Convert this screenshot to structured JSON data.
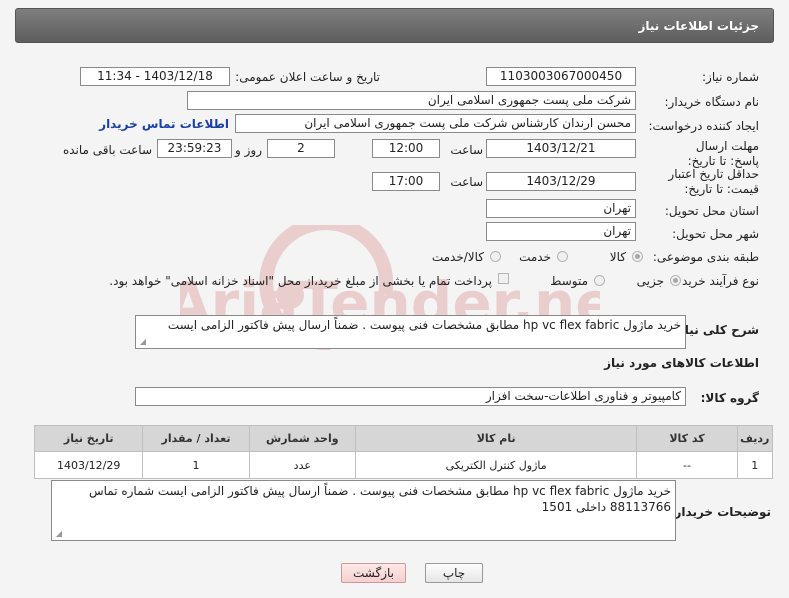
{
  "header": {
    "title": "جزئیات اطلاعات نیاز"
  },
  "fields": {
    "need_number_label": "شماره نیاز:",
    "need_number": "1103003067000450",
    "announce_label": "تاریخ و ساعت اعلان عمومی:",
    "announce_value": "1403/12/18 - 11:34",
    "buyer_org_label": "نام دستگاه خریدار:",
    "buyer_org": "شرکت ملی پست جمهوری اسلامی ایران",
    "requester_label": "ایجاد کننده درخواست:",
    "requester": "محسن ارندان کارشناس شرکت ملی پست جمهوری اسلامی ایران",
    "buyer_contact_link": "اطلاعات تماس خریدار",
    "reply_deadline_label": "مهلت ارسال پاسخ: تا تاریخ:",
    "reply_date": "1403/12/21",
    "time_label": "ساعت",
    "reply_time": "12:00",
    "days": "2",
    "days_label": "روز و",
    "remaining_time": "23:59:23",
    "remaining_label": "ساعت باقی مانده",
    "price_validity_label": "حداقل تاریخ اعتبار قیمت: تا تاریخ:",
    "price_date": "1403/12/29",
    "price_time": "17:00",
    "province_label": "استان محل تحویل:",
    "province": "تهران",
    "city_label": "شهر محل تحویل:",
    "city": "تهران",
    "category_label": "طبقه بندی موضوعی:",
    "category_options": [
      "کالا",
      "خدمت",
      "کالا/خدمت"
    ],
    "process_label": "نوع فرآیند خرید :",
    "process_options": [
      "جزیی",
      "متوسط"
    ],
    "payment_note": "پرداخت تمام یا بخشی از مبلغ خرید،از محل \"اسناد خزانه اسلامی\" خواهد بود."
  },
  "description": {
    "label": "شرح کلی نیاز:",
    "text": "خرید ماژول hp vc flex fabric مطابق مشخصات فنی پیوست . ضمناً ارسال پیش فاکتور الزامی ایست"
  },
  "goods_section": {
    "title": "اطلاعات کالاهای مورد نیاز",
    "group_label": "گروه کالا:",
    "group_value": "کامپیوتر و فناوری اطلاعات-سخت افزار"
  },
  "table": {
    "headers": [
      "ردیف",
      "کد کالا",
      "نام کالا",
      "واحد شمارش",
      "تعداد / مقدار",
      "تاریخ نیاز"
    ],
    "rows": [
      [
        "1",
        "--",
        "ماژول کنترل الکتریکی",
        "عدد",
        "1",
        "1403/12/29"
      ]
    ]
  },
  "buyer_notes": {
    "label": "توضیحات خریدار:",
    "text": "خرید ماژول hp vc flex fabric مطابق مشخصات فنی پیوست . ضمناً ارسال پیش فاکتور الزامی ایست شماره تماس 88113766 داخلی 1501"
  },
  "buttons": {
    "print": "چاپ",
    "back": "بازگشت"
  },
  "watermark_text": "AriaTender.neT",
  "colors": {
    "header": "#6e6e6e",
    "link": "#1a3fa8",
    "watermark": "#e2b0b0"
  }
}
